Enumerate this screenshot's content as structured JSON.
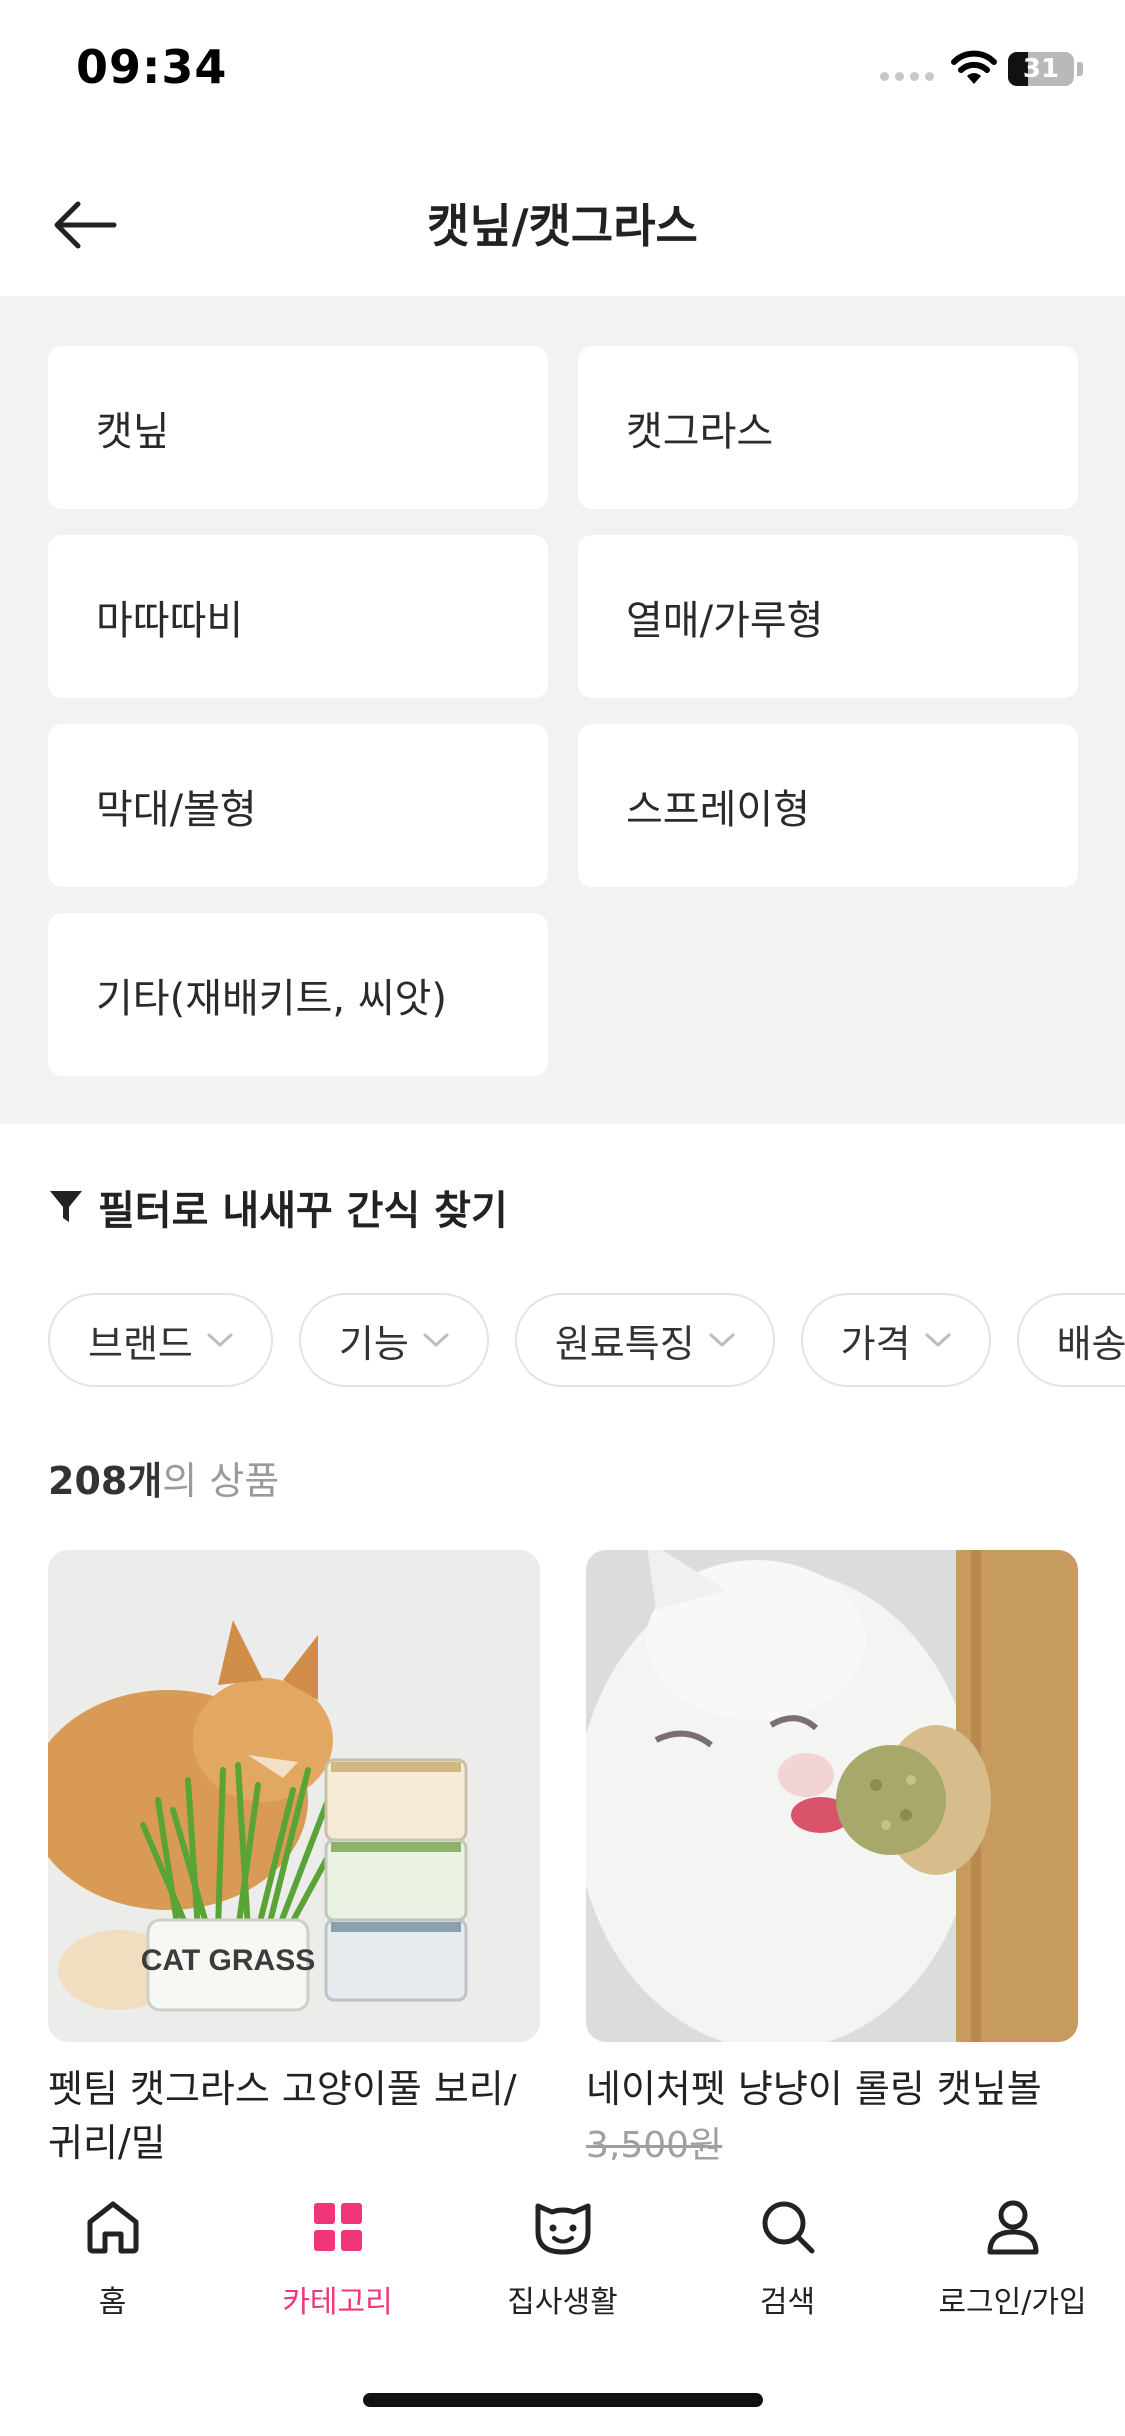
{
  "status_bar": {
    "time": "09:34",
    "battery_level": "31"
  },
  "header": {
    "title": "캣닢/캣그라스"
  },
  "categories": [
    "캣닢",
    "캣그라스",
    "마따따비",
    "열매/가루형",
    "막대/볼형",
    "스프레이형",
    "기타(재배키트, 씨앗)"
  ],
  "filter": {
    "heading": "필터로 내새꾸 간식 찾기",
    "chips": [
      "브랜드",
      "기능",
      "원료특징",
      "가격",
      "배송"
    ]
  },
  "product_count": {
    "number": "208개",
    "suffix": "의 상품"
  },
  "products": [
    {
      "name": "펫팀 캣그라스 고양이풀 보리/귀리/밀",
      "price": ""
    },
    {
      "name": "네이처펫 냥냥이 롤링 캣닢볼",
      "price": "3,500원"
    }
  ],
  "product_image_text": {
    "can_label": "CAT GRASS"
  },
  "bottom_nav": [
    {
      "label": "홈",
      "icon": "home-icon",
      "active": false
    },
    {
      "label": "카테고리",
      "icon": "category-grid-icon",
      "active": true
    },
    {
      "label": "집사생활",
      "icon": "cat-face-icon",
      "active": false
    },
    {
      "label": "검색",
      "icon": "search-icon",
      "active": false
    },
    {
      "label": "로그인/가입",
      "icon": "user-icon",
      "active": false
    }
  ],
  "colors": {
    "accent": "#f0357a",
    "section_bg": "#f2f2f2"
  }
}
